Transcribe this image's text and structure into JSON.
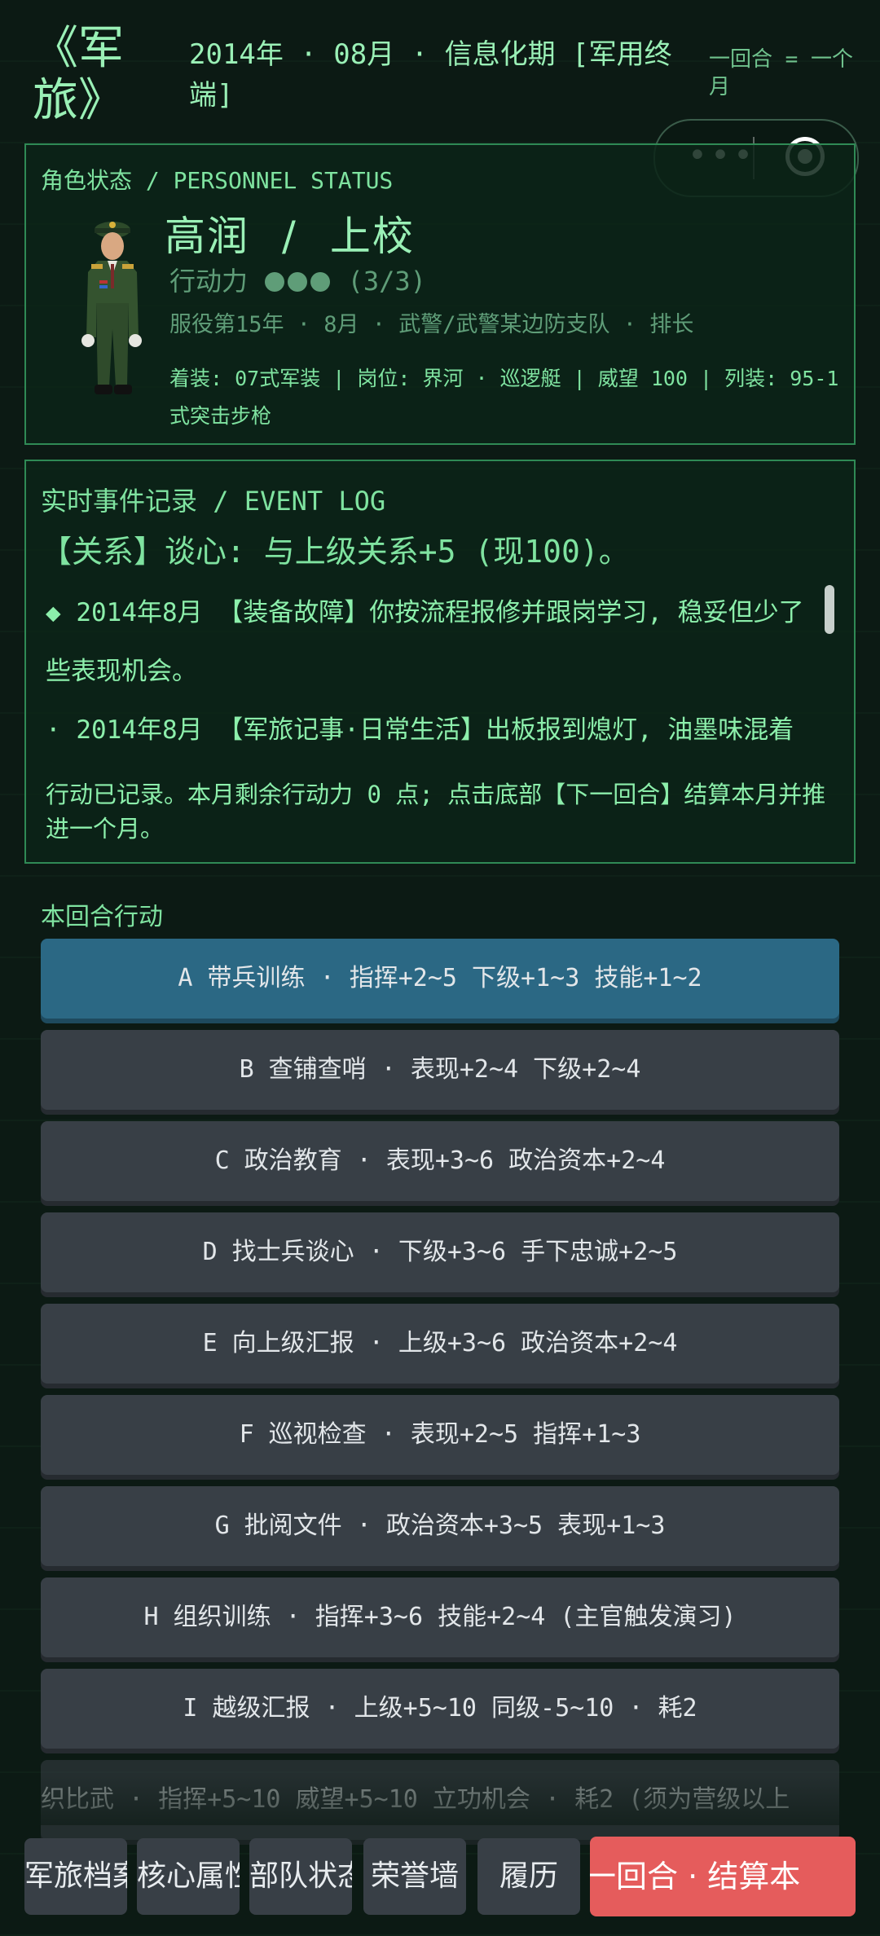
{
  "header": {
    "app_title": "《军旅》",
    "date_line": "2014年 · 08月 · 信息化期 [军用终端]",
    "note": "一回合 = 一个月"
  },
  "status": {
    "label": "角色状态 / PERSONNEL STATUS",
    "name": "高润",
    "rank": "上校",
    "separator": "/",
    "ap_label": "行动力",
    "ap_value": "(3/3)",
    "service_info": "服役第15年 · 8月 · 武警/武警某边防支队 · 排长",
    "equipment_info": "着装: 07式军装 | 岗位: 界河 · 巡逻艇 | 威望 100 | 列装: 95-1式突击步枪"
  },
  "events": {
    "label": "实时事件记录 / EVENT LOG",
    "headline": "【关系】谈心: 与上级关系+5 (现100)。",
    "items": [
      "◆ 2014年8月 【装备故障】你按流程报修并跟岗学习, 稳妥但少了些表现机会。",
      "· 2014年8月 【军旅记事·日常生活】出板报到熄灯, 油墨味混着"
    ],
    "note": "行动已记录。本月剩余行动力 0 点; 点击底部【下一回合】结算本月并推进一个月。"
  },
  "actions": {
    "title": "本回合行动",
    "items": [
      "A  带兵训练 · 指挥+2~5 下级+1~3 技能+1~2",
      "B  查铺查哨 · 表现+2~4 下级+2~4",
      "C  政治教育 · 表现+3~6 政治资本+2~4",
      "D  找士兵谈心 · 下级+3~6 手下忠诚+2~5",
      "E  向上级汇报 · 上级+3~6 政治资本+2~4",
      "F  巡视检查 · 表现+2~5 指挥+1~3",
      "G  批阅文件 · 政治资本+3~5 表现+1~3",
      "H  组织训练 · 指挥+3~6 技能+2~4 (主官触发演习)",
      "I  越级汇报 · 上级+5~10 同级-5~10 · 耗2",
      "织比武 · 指挥+5~10 威望+5~10 立功机会 · 耗2 (须为营级以上"
    ]
  },
  "tabs": {
    "archive": "军旅档案",
    "attributes": "核心属性",
    "unit": "部队状态",
    "honor": "荣誉墙",
    "resume": "履历",
    "next": "一回合 · 结算本"
  },
  "colors": {
    "background": "#0c1a14",
    "accent_green": "#7fe3a0",
    "active_action": "#2b6884",
    "next_button": "#e55c5c"
  },
  "icons": [
    "more-dots-icon",
    "target-icon",
    "officer-portrait"
  ]
}
